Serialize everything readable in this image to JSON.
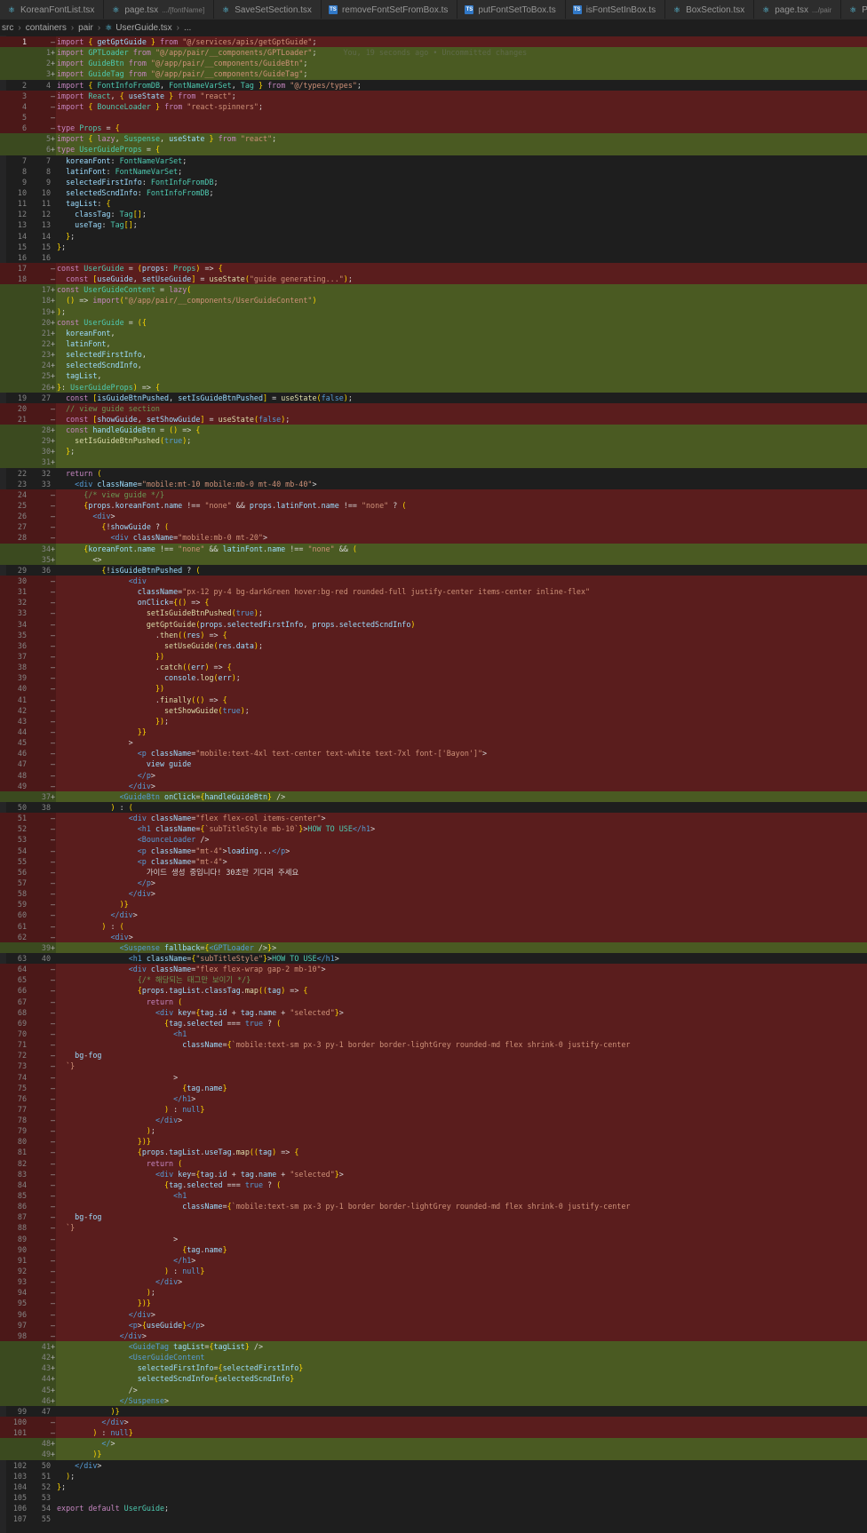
{
  "tabs": [
    {
      "label": "KoreanFontList.tsx",
      "desc": "",
      "icon": "react-icon",
      "active": false
    },
    {
      "label": "page.tsx",
      "desc": ".../[fontName]",
      "icon": "react-icon",
      "active": false
    },
    {
      "label": "SaveSetSection.tsx",
      "desc": "",
      "icon": "react-icon",
      "active": false
    },
    {
      "label": "removeFontSetFromBox.ts",
      "desc": "",
      "icon": "ts-icon",
      "active": false
    },
    {
      "label": "putFontSetToBox.ts",
      "desc": "",
      "icon": "ts-icon",
      "active": false
    },
    {
      "label": "isFontSetInBox.ts",
      "desc": "",
      "icon": "ts-icon",
      "active": false
    },
    {
      "label": "BoxSection.tsx",
      "desc": "",
      "icon": "react-icon",
      "active": false
    },
    {
      "label": "page.tsx",
      "desc": ".../pair",
      "icon": "react-icon",
      "active": false
    },
    {
      "label": "Pair",
      "desc": "",
      "icon": "react-icon",
      "active": false
    }
  ],
  "breadcrumb": [
    "src",
    "containers",
    "pair",
    "UserGuide.tsx",
    "..."
  ],
  "blame": "You, 19 seconds ago • Uncommitted changes",
  "colors": {
    "deleted": "#4b1818",
    "inserted": "#3b4a1f",
    "editor": "#1e1e1e",
    "tabbar": "#252526"
  },
  "lines": [
    {
      "o": "1",
      "n": "",
      "m": "-",
      "k": "del",
      "x": "import { getGptGuide } from \"@/services/apis/getGptGuide\";"
    },
    {
      "o": "",
      "n": "1",
      "m": "+",
      "k": "ins",
      "x": "import GPTLoader from \"@/app/pair/__components/GPTLoader\";",
      "blame": true
    },
    {
      "o": "",
      "n": "2",
      "m": "+",
      "k": "ins",
      "x": "import GuideBtn from \"@/app/pair/__components/GuideBtn\";"
    },
    {
      "o": "",
      "n": "3",
      "m": "+",
      "k": "ins",
      "x": "import GuideTag from \"@/app/pair/__components/GuideTag\";"
    },
    {
      "o": "2",
      "n": "4",
      "m": "",
      "k": "",
      "x": "import { FontInfoFromDB, FontNameVarSet, Tag } from \"@/types/types\";"
    },
    {
      "o": "3",
      "n": "",
      "m": "-",
      "k": "del",
      "x": "import React, { useState } from \"react\";"
    },
    {
      "o": "4",
      "n": "",
      "m": "-",
      "k": "del",
      "x": "import { BounceLoader } from \"react-spinners\";"
    },
    {
      "o": "5",
      "n": "",
      "m": "-",
      "k": "del",
      "x": ""
    },
    {
      "o": "6",
      "n": "",
      "m": "-",
      "k": "del",
      "x": "type Props = {"
    },
    {
      "o": "",
      "n": "5",
      "m": "+",
      "k": "ins",
      "x": "import { lazy, Suspense, useState } from \"react\";"
    },
    {
      "o": "",
      "n": "6",
      "m": "+",
      "k": "ins",
      "x": "type UserGuideProps = {"
    },
    {
      "o": "7",
      "n": "7",
      "m": "",
      "k": "",
      "x": "  koreanFont: FontNameVarSet;"
    },
    {
      "o": "8",
      "n": "8",
      "m": "",
      "k": "",
      "x": "  latinFont: FontNameVarSet;"
    },
    {
      "o": "9",
      "n": "9",
      "m": "",
      "k": "",
      "x": "  selectedFirstInfo: FontInfoFromDB;"
    },
    {
      "o": "10",
      "n": "10",
      "m": "",
      "k": "",
      "x": "  selectedScndInfo: FontInfoFromDB;"
    },
    {
      "o": "11",
      "n": "11",
      "m": "",
      "k": "",
      "x": "  tagList: {"
    },
    {
      "o": "12",
      "n": "12",
      "m": "",
      "k": "",
      "x": "    classTag: Tag[];"
    },
    {
      "o": "13",
      "n": "13",
      "m": "",
      "k": "",
      "x": "    useTag: Tag[];"
    },
    {
      "o": "14",
      "n": "14",
      "m": "",
      "k": "",
      "x": "  };"
    },
    {
      "o": "15",
      "n": "15",
      "m": "",
      "k": "",
      "x": "};"
    },
    {
      "o": "16",
      "n": "16",
      "m": "",
      "k": "",
      "x": ""
    },
    {
      "o": "17",
      "n": "",
      "m": "-",
      "k": "del",
      "x": "const UserGuide = (props: Props) => {"
    },
    {
      "o": "18",
      "n": "",
      "m": "-",
      "k": "del",
      "x": "  const [useGuide, setUseGuide] = useState(\"guide generating...\");"
    },
    {
      "o": "",
      "n": "17",
      "m": "+",
      "k": "ins",
      "x": "const UserGuideContent = lazy("
    },
    {
      "o": "",
      "n": "18",
      "m": "+",
      "k": "ins",
      "x": "  () => import(\"@/app/pair/__components/UserGuideContent\")"
    },
    {
      "o": "",
      "n": "19",
      "m": "+",
      "k": "ins",
      "x": ");"
    },
    {
      "o": "",
      "n": "20",
      "m": "+",
      "k": "ins",
      "x": "const UserGuide = ({"
    },
    {
      "o": "",
      "n": "21",
      "m": "+",
      "k": "ins",
      "x": "  koreanFont,"
    },
    {
      "o": "",
      "n": "22",
      "m": "+",
      "k": "ins",
      "x": "  latinFont,"
    },
    {
      "o": "",
      "n": "23",
      "m": "+",
      "k": "ins",
      "x": "  selectedFirstInfo,"
    },
    {
      "o": "",
      "n": "24",
      "m": "+",
      "k": "ins",
      "x": "  selectedScndInfo,"
    },
    {
      "o": "",
      "n": "25",
      "m": "+",
      "k": "ins",
      "x": "  tagList,"
    },
    {
      "o": "",
      "n": "26",
      "m": "+",
      "k": "ins",
      "x": "}: UserGuideProps) => {"
    },
    {
      "o": "19",
      "n": "27",
      "m": "",
      "k": "",
      "x": "  const [isGuideBtnPushed, setIsGuideBtnPushed] = useState(false);"
    },
    {
      "o": "20",
      "n": "",
      "m": "-",
      "k": "del",
      "x": "  // view guide section"
    },
    {
      "o": "21",
      "n": "",
      "m": "-",
      "k": "del",
      "x": "  const [showGuide, setShowGuide] = useState(false);"
    },
    {
      "o": "",
      "n": "28",
      "m": "+",
      "k": "ins",
      "x": "  const handleGuideBtn = () => {"
    },
    {
      "o": "",
      "n": "29",
      "m": "+",
      "k": "ins",
      "x": "    setIsGuideBtnPushed(true);"
    },
    {
      "o": "",
      "n": "30",
      "m": "+",
      "k": "ins",
      "x": "  };"
    },
    {
      "o": "",
      "n": "31",
      "m": "+",
      "k": "ins",
      "x": ""
    },
    {
      "o": "22",
      "n": "32",
      "m": "",
      "k": "",
      "x": "  return ("
    },
    {
      "o": "23",
      "n": "33",
      "m": "",
      "k": "",
      "x": "    <div className=\"mobile:mt-10 mobile:mb-0 mt-40 mb-40\">"
    },
    {
      "o": "24",
      "n": "",
      "m": "-",
      "k": "del",
      "x": "      {/* view guide */}"
    },
    {
      "o": "25",
      "n": "",
      "m": "-",
      "k": "del",
      "x": "      {props.koreanFont.name !== \"none\" && props.latinFont.name !== \"none\" ? ("
    },
    {
      "o": "26",
      "n": "",
      "m": "-",
      "k": "del",
      "x": "        <div>"
    },
    {
      "o": "27",
      "n": "",
      "m": "-",
      "k": "del",
      "x": "          {!showGuide ? ("
    },
    {
      "o": "28",
      "n": "",
      "m": "-",
      "k": "del",
      "x": "            <div className=\"mobile:mb-0 mt-20\">"
    },
    {
      "o": "",
      "n": "34",
      "m": "+",
      "k": "ins",
      "x": "      {koreanFont.name !== \"none\" && latinFont.name !== \"none\" && ("
    },
    {
      "o": "",
      "n": "35",
      "m": "+",
      "k": "ins",
      "x": "        <>"
    },
    {
      "o": "29",
      "n": "36",
      "m": "",
      "k": "",
      "x": "          {!isGuideBtnPushed ? ("
    },
    {
      "o": "30",
      "n": "",
      "m": "-",
      "k": "del",
      "x": "                <div"
    },
    {
      "o": "31",
      "n": "",
      "m": "-",
      "k": "del",
      "x": "                  className=\"px-12 py-4 bg-darkGreen hover:bg-red rounded-full justify-center items-center inline-flex\""
    },
    {
      "o": "32",
      "n": "",
      "m": "-",
      "k": "del",
      "x": "                  onClick={() => {"
    },
    {
      "o": "33",
      "n": "",
      "m": "-",
      "k": "del",
      "x": "                    setIsGuideBtnPushed(true);"
    },
    {
      "o": "34",
      "n": "",
      "m": "-",
      "k": "del",
      "x": "                    getGptGuide(props.selectedFirstInfo, props.selectedScndInfo)"
    },
    {
      "o": "35",
      "n": "",
      "m": "-",
      "k": "del",
      "x": "                      .then((res) => {"
    },
    {
      "o": "36",
      "n": "",
      "m": "-",
      "k": "del",
      "x": "                        setUseGuide(res.data);"
    },
    {
      "o": "37",
      "n": "",
      "m": "-",
      "k": "del",
      "x": "                      })"
    },
    {
      "o": "38",
      "n": "",
      "m": "-",
      "k": "del",
      "x": "                      .catch((err) => {"
    },
    {
      "o": "39",
      "n": "",
      "m": "-",
      "k": "del",
      "x": "                        console.log(err);"
    },
    {
      "o": "40",
      "n": "",
      "m": "-",
      "k": "del",
      "x": "                      })"
    },
    {
      "o": "41",
      "n": "",
      "m": "-",
      "k": "del",
      "x": "                      .finally(() => {"
    },
    {
      "o": "42",
      "n": "",
      "m": "-",
      "k": "del",
      "x": "                        setShowGuide(true);"
    },
    {
      "o": "43",
      "n": "",
      "m": "-",
      "k": "del",
      "x": "                      });"
    },
    {
      "o": "44",
      "n": "",
      "m": "-",
      "k": "del",
      "x": "                  }}"
    },
    {
      "o": "45",
      "n": "",
      "m": "-",
      "k": "del",
      "x": "                >"
    },
    {
      "o": "46",
      "n": "",
      "m": "-",
      "k": "del",
      "x": "                  <p className=\"mobile:text-4xl text-center text-white text-7xl font-['Bayon']\">"
    },
    {
      "o": "47",
      "n": "",
      "m": "-",
      "k": "del",
      "x": "                    view guide"
    },
    {
      "o": "48",
      "n": "",
      "m": "-",
      "k": "del",
      "x": "                  </p>"
    },
    {
      "o": "49",
      "n": "",
      "m": "-",
      "k": "del",
      "x": "                </div>"
    },
    {
      "o": "",
      "n": "37",
      "m": "+",
      "k": "ins",
      "x": "              <GuideBtn onClick={handleGuideBtn} />"
    },
    {
      "o": "50",
      "n": "38",
      "m": "",
      "k": "",
      "x": "            ) : ("
    },
    {
      "o": "51",
      "n": "",
      "m": "-",
      "k": "del",
      "x": "                <div className=\"flex flex-col items-center\">"
    },
    {
      "o": "52",
      "n": "",
      "m": "-",
      "k": "del",
      "x": "                  <h1 className={`subTitleStyle mb-10`}>HOW TO USE</h1>"
    },
    {
      "o": "53",
      "n": "",
      "m": "-",
      "k": "del",
      "x": "                  <BounceLoader />"
    },
    {
      "o": "54",
      "n": "",
      "m": "-",
      "k": "del",
      "x": "                  <p className=\"mt-4\">loading...</p>"
    },
    {
      "o": "55",
      "n": "",
      "m": "-",
      "k": "del",
      "x": "                  <p className=\"mt-4\">"
    },
    {
      "o": "56",
      "n": "",
      "m": "-",
      "k": "del",
      "x": "                    가이드 생성 중입니다! 30초만 기다려 주세요"
    },
    {
      "o": "57",
      "n": "",
      "m": "-",
      "k": "del",
      "x": "                  </p>"
    },
    {
      "o": "58",
      "n": "",
      "m": "-",
      "k": "del",
      "x": "                </div>"
    },
    {
      "o": "59",
      "n": "",
      "m": "-",
      "k": "del",
      "x": "              )}"
    },
    {
      "o": "60",
      "n": "",
      "m": "-",
      "k": "del",
      "x": "            </div>"
    },
    {
      "o": "61",
      "n": "",
      "m": "-",
      "k": "del",
      "x": "          ) : ("
    },
    {
      "o": "62",
      "n": "",
      "m": "-",
      "k": "del",
      "x": "            <div>"
    },
    {
      "o": "",
      "n": "39",
      "m": "+",
      "k": "ins",
      "x": "              <Suspense fallback={<GPTLoader />}>"
    },
    {
      "o": "63",
      "n": "40",
      "m": "",
      "k": "",
      "x": "                <h1 className={\"subTitleStyle\"}>HOW TO USE</h1>"
    },
    {
      "o": "64",
      "n": "",
      "m": "-",
      "k": "del",
      "x": "                <div className=\"flex flex-wrap gap-2 mb-10\">"
    },
    {
      "o": "65",
      "n": "",
      "m": "-",
      "k": "del",
      "x": "                  {/* 해당되는 태그만 보이기 */}"
    },
    {
      "o": "66",
      "n": "",
      "m": "-",
      "k": "del",
      "x": "                  {props.tagList.classTag.map((tag) => {"
    },
    {
      "o": "67",
      "n": "",
      "m": "-",
      "k": "del",
      "x": "                    return ("
    },
    {
      "o": "68",
      "n": "",
      "m": "-",
      "k": "del",
      "x": "                      <div key={tag.id + tag.name + \"selected\"}>"
    },
    {
      "o": "69",
      "n": "",
      "m": "-",
      "k": "del",
      "x": "                        {tag.selected === true ? ("
    },
    {
      "o": "70",
      "n": "",
      "m": "-",
      "k": "del",
      "x": "                          <h1"
    },
    {
      "o": "71",
      "n": "",
      "m": "-",
      "k": "del",
      "x": "                            className={`mobile:text-sm px-3 py-1 border border-lightGrey rounded-md flex shrink-0 justify-center"
    },
    {
      "o": "72",
      "n": "",
      "m": "-",
      "k": "del",
      "x": "    bg-fog"
    },
    {
      "o": "73",
      "n": "",
      "m": "-",
      "k": "del",
      "x": "  `}"
    },
    {
      "o": "74",
      "n": "",
      "m": "-",
      "k": "del",
      "x": "                          >"
    },
    {
      "o": "75",
      "n": "",
      "m": "-",
      "k": "del",
      "x": "                            {tag.name}"
    },
    {
      "o": "76",
      "n": "",
      "m": "-",
      "k": "del",
      "x": "                          </h1>"
    },
    {
      "o": "77",
      "n": "",
      "m": "-",
      "k": "del",
      "x": "                        ) : null}"
    },
    {
      "o": "78",
      "n": "",
      "m": "-",
      "k": "del",
      "x": "                      </div>"
    },
    {
      "o": "79",
      "n": "",
      "m": "-",
      "k": "del",
      "x": "                    );"
    },
    {
      "o": "80",
      "n": "",
      "m": "-",
      "k": "del",
      "x": "                  })}"
    },
    {
      "o": "81",
      "n": "",
      "m": "-",
      "k": "del",
      "x": "                  {props.tagList.useTag.map((tag) => {"
    },
    {
      "o": "82",
      "n": "",
      "m": "-",
      "k": "del",
      "x": "                    return ("
    },
    {
      "o": "83",
      "n": "",
      "m": "-",
      "k": "del",
      "x": "                      <div key={tag.id + tag.name + \"selected\"}>"
    },
    {
      "o": "84",
      "n": "",
      "m": "-",
      "k": "del",
      "x": "                        {tag.selected === true ? ("
    },
    {
      "o": "85",
      "n": "",
      "m": "-",
      "k": "del",
      "x": "                          <h1"
    },
    {
      "o": "86",
      "n": "",
      "m": "-",
      "k": "del",
      "x": "                            className={`mobile:text-sm px-3 py-1 border border-lightGrey rounded-md flex shrink-0 justify-center"
    },
    {
      "o": "87",
      "n": "",
      "m": "-",
      "k": "del",
      "x": "    bg-fog"
    },
    {
      "o": "88",
      "n": "",
      "m": "-",
      "k": "del",
      "x": "  `}"
    },
    {
      "o": "89",
      "n": "",
      "m": "-",
      "k": "del",
      "x": "                          >"
    },
    {
      "o": "90",
      "n": "",
      "m": "-",
      "k": "del",
      "x": "                            {tag.name}"
    },
    {
      "o": "91",
      "n": "",
      "m": "-",
      "k": "del",
      "x": "                          </h1>"
    },
    {
      "o": "92",
      "n": "",
      "m": "-",
      "k": "del",
      "x": "                        ) : null}"
    },
    {
      "o": "93",
      "n": "",
      "m": "-",
      "k": "del",
      "x": "                      </div>"
    },
    {
      "o": "94",
      "n": "",
      "m": "-",
      "k": "del",
      "x": "                    );"
    },
    {
      "o": "95",
      "n": "",
      "m": "-",
      "k": "del",
      "x": "                  })}"
    },
    {
      "o": "96",
      "n": "",
      "m": "-",
      "k": "del",
      "x": "                </div>"
    },
    {
      "o": "97",
      "n": "",
      "m": "-",
      "k": "del",
      "x": "                <p>{useGuide}</p>"
    },
    {
      "o": "98",
      "n": "",
      "m": "-",
      "k": "del",
      "x": "              </div>"
    },
    {
      "o": "",
      "n": "41",
      "m": "+",
      "k": "ins",
      "x": "                <GuideTag tagList={tagList} />"
    },
    {
      "o": "",
      "n": "42",
      "m": "+",
      "k": "ins",
      "x": "                <UserGuideContent"
    },
    {
      "o": "",
      "n": "43",
      "m": "+",
      "k": "ins",
      "x": "                  selectedFirstInfo={selectedFirstInfo}"
    },
    {
      "o": "",
      "n": "44",
      "m": "+",
      "k": "ins",
      "x": "                  selectedScndInfo={selectedScndInfo}"
    },
    {
      "o": "",
      "n": "45",
      "m": "+",
      "k": "ins",
      "x": "                />"
    },
    {
      "o": "",
      "n": "46",
      "m": "+",
      "k": "ins",
      "x": "              </Suspense>"
    },
    {
      "o": "99",
      "n": "47",
      "m": "",
      "k": "",
      "x": "            )}"
    },
    {
      "o": "100",
      "n": "",
      "m": "-",
      "k": "del",
      "x": "          </div>"
    },
    {
      "o": "101",
      "n": "",
      "m": "-",
      "k": "del",
      "x": "        ) : null}"
    },
    {
      "o": "",
      "n": "48",
      "m": "+",
      "k": "ins",
      "x": "          </>"
    },
    {
      "o": "",
      "n": "49",
      "m": "+",
      "k": "ins",
      "x": "        )}"
    },
    {
      "o": "102",
      "n": "50",
      "m": "",
      "k": "",
      "x": "    </div>"
    },
    {
      "o": "103",
      "n": "51",
      "m": "",
      "k": "",
      "x": "  );"
    },
    {
      "o": "104",
      "n": "52",
      "m": "",
      "k": "",
      "x": "};"
    },
    {
      "o": "105",
      "n": "53",
      "m": "",
      "k": "",
      "x": ""
    },
    {
      "o": "106",
      "n": "54",
      "m": "",
      "k": "",
      "x": "export default UserGuide;"
    },
    {
      "o": "107",
      "n": "55",
      "m": "",
      "k": "",
      "x": ""
    }
  ]
}
